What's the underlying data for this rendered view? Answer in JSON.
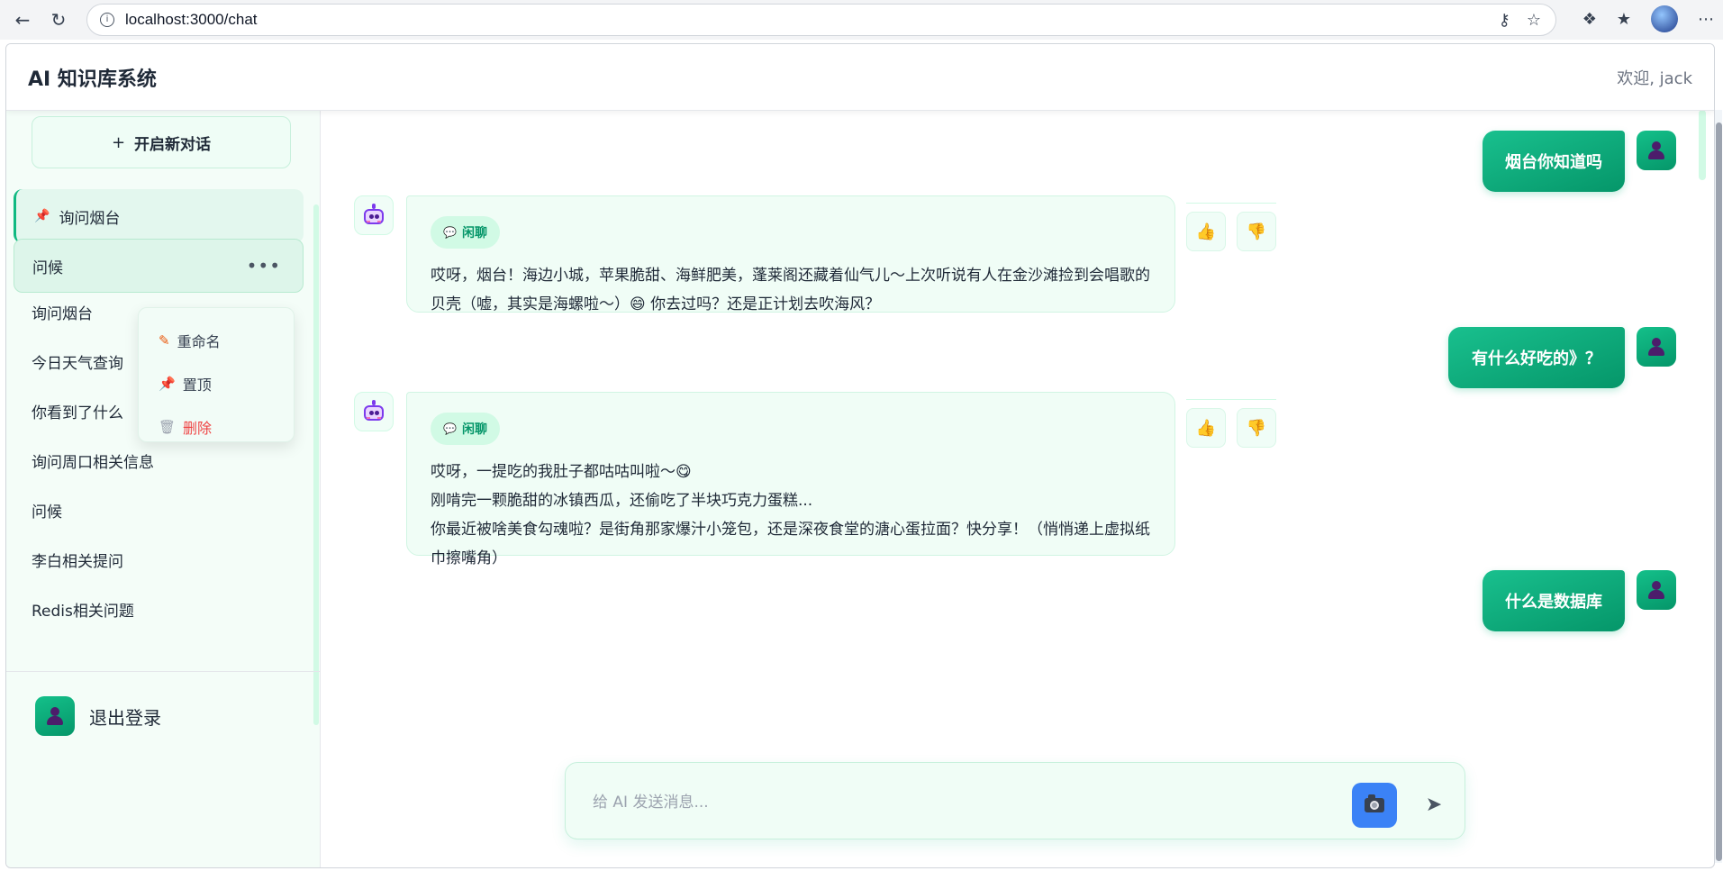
{
  "browser": {
    "url": "localhost:3000/chat"
  },
  "header": {
    "title": "AI 知识库系统",
    "welcome": "欢迎, jack"
  },
  "sidebar": {
    "new_chat_label": "开启新对话",
    "items": [
      {
        "label": "询问烟台",
        "pinned": true
      },
      {
        "label": "问候",
        "hovered": true
      },
      {
        "label": "询问烟台"
      },
      {
        "label": "今日天气查询"
      },
      {
        "label": "你看到了什么"
      },
      {
        "label": "询问周口相关信息"
      },
      {
        "label": "问候"
      },
      {
        "label": "李白相关提问"
      },
      {
        "label": "Redis相关问题"
      }
    ],
    "context_menu": {
      "rename": "重命名",
      "pin": "置顶",
      "delete": "删除"
    },
    "logout_label": "退出登录"
  },
  "chat": {
    "messages": [
      {
        "role": "user",
        "text": "烟台你知道吗"
      },
      {
        "role": "assistant",
        "tag": "闲聊",
        "lines": [
          "哎呀，烟台！海边小城，苹果脆甜、海鲜肥美，蓬莱阁还藏着仙气儿～上次听说有人在金沙滩捡到会唱歌的贝壳（嘘，其实是海螺啦～）😄 你去过吗？还是正计划去吹海风？"
        ]
      },
      {
        "role": "user",
        "text": "有什么好吃的》？"
      },
      {
        "role": "assistant",
        "tag": "闲聊",
        "lines": [
          "哎呀，一提吃的我肚子都咕咕叫啦～😋",
          "刚啃完一颗脆甜的冰镇西瓜，还偷吃了半块巧克力蛋糕...",
          "你最近被啥美食勾魂啦？是街角那家爆汁小笼包，还是深夜食堂的溏心蛋拉面？快分享！（悄悄递上虚拟纸巾擦嘴角）"
        ]
      },
      {
        "role": "user",
        "text": "什么是数据库"
      }
    ]
  },
  "composer": {
    "placeholder": "给 AI 发送消息..."
  },
  "colors": {
    "accent": "#10b981",
    "accent_dark": "#059669",
    "sidebar_bg": "#f4fdf8",
    "bot_bubble_bg": "#f0fdf6",
    "camera_button": "#3b82f6",
    "danger": "#ef4444"
  },
  "icons": {
    "back": "back-arrow-icon",
    "reload": "reload-icon",
    "site_info": "info-icon",
    "pin": "pin-icon",
    "rename": "pencil-icon",
    "delete": "trash-icon",
    "more": "more-dots-icon",
    "like": "thumbs-up-icon",
    "dislike": "thumbs-down-icon",
    "camera": "camera-icon",
    "send": "send-icon"
  }
}
